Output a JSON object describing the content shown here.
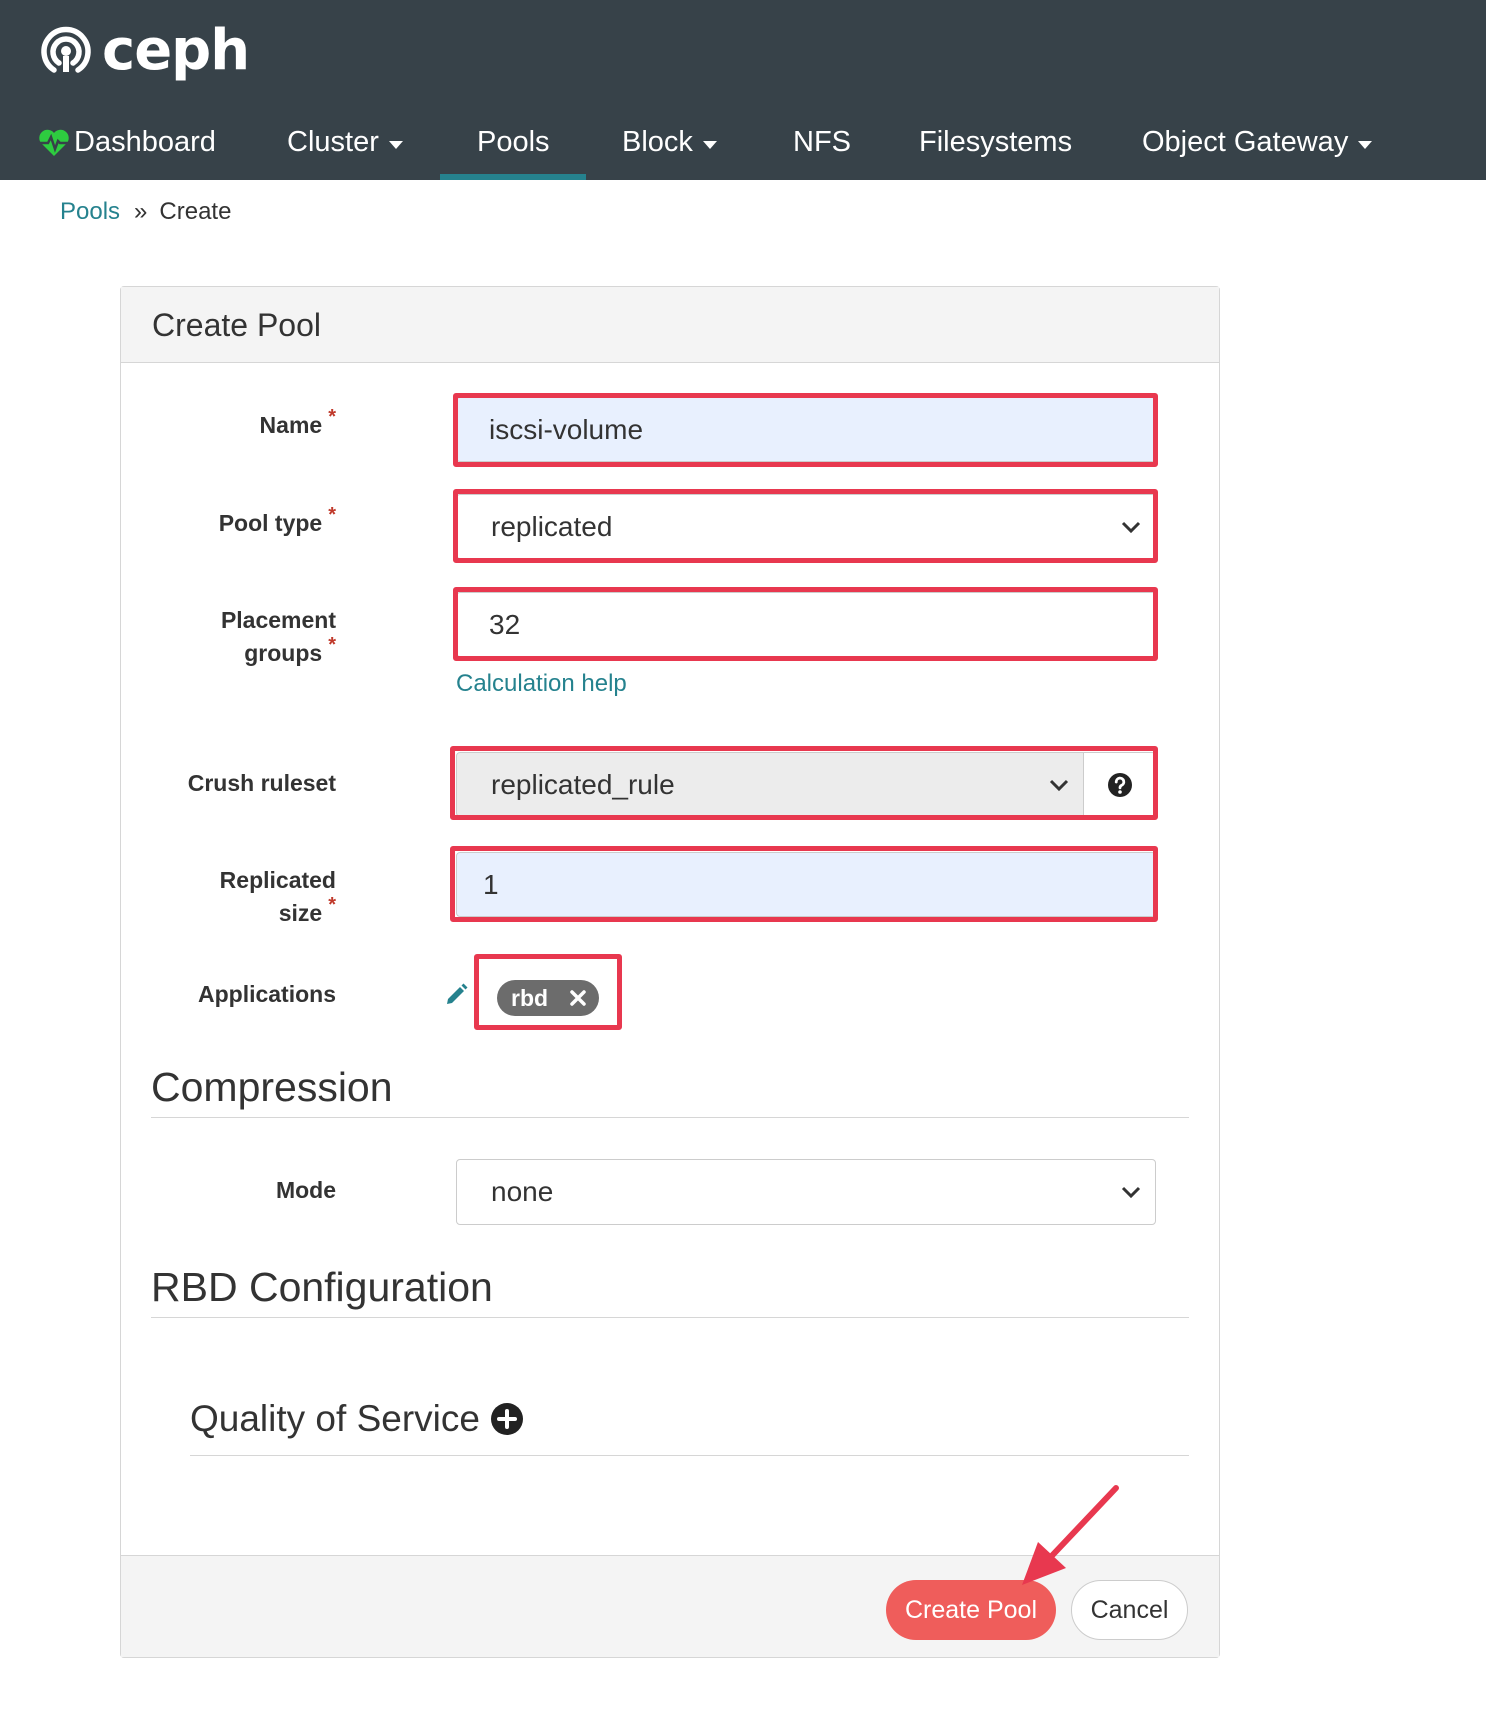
{
  "brand": {
    "name": "ceph"
  },
  "nav": {
    "items": [
      {
        "label": "Dashboard"
      },
      {
        "label": "Cluster"
      },
      {
        "label": "Pools"
      },
      {
        "label": "Block"
      },
      {
        "label": "NFS"
      },
      {
        "label": "Filesystems"
      },
      {
        "label": "Object Gateway"
      }
    ],
    "active": "Pools"
  },
  "breadcrumb": {
    "parent": "Pools",
    "separator": "»",
    "current": "Create"
  },
  "form": {
    "title": "Create Pool",
    "required_mark": "*",
    "name": {
      "label": "Name",
      "value": "iscsi-volume"
    },
    "pool_type": {
      "label": "Pool type",
      "value": "replicated"
    },
    "placement_groups": {
      "label_line1": "Placement",
      "label_line2": "groups",
      "value": "32",
      "help_link": "Calculation help"
    },
    "crush_ruleset": {
      "label": "Crush ruleset",
      "value": "replicated_rule"
    },
    "replicated_size": {
      "label_line1": "Replicated",
      "label_line2": "size",
      "value": "1"
    },
    "applications": {
      "label": "Applications",
      "tags": [
        "rbd"
      ]
    }
  },
  "compression": {
    "title": "Compression",
    "mode": {
      "label": "Mode",
      "value": "none"
    }
  },
  "rbd": {
    "title": "RBD Configuration",
    "qos_title": "Quality of Service"
  },
  "footer": {
    "submit_label": "Create Pool",
    "cancel_label": "Cancel"
  },
  "colors": {
    "header_bg": "#374249",
    "accent": "#25828e",
    "primary_button": "#ef5d5b",
    "highlight": "#e8384f",
    "heart": "#2ecc40"
  },
  "icons": [
    "ceph-logo-icon",
    "heartbeat-icon",
    "chevron-down-icon",
    "question-circle-icon",
    "pencil-icon",
    "times-icon",
    "plus-circle-icon",
    "annotation-arrow"
  ]
}
